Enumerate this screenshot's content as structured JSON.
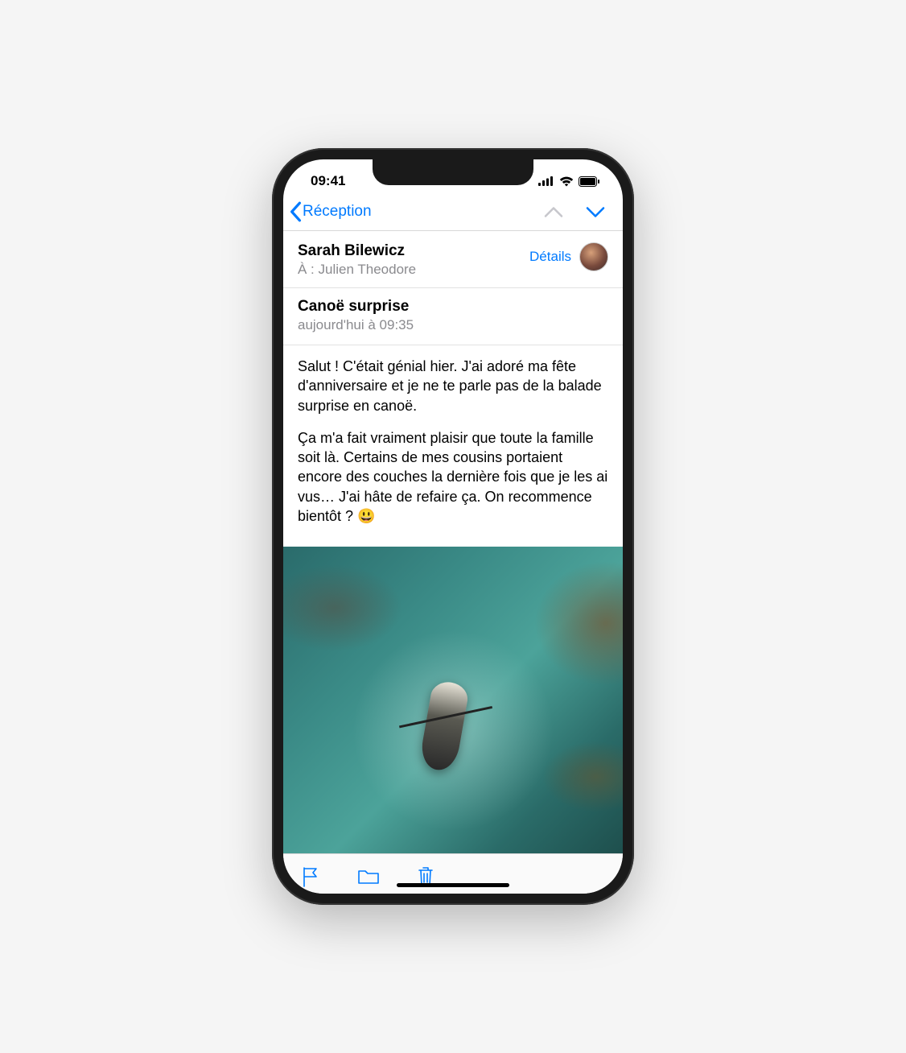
{
  "status": {
    "time": "09:41"
  },
  "nav": {
    "back_label": "Réception"
  },
  "email": {
    "sender": "Sarah Bilewicz",
    "to_label": "À :",
    "recipient": "Julien Theodore",
    "details_label": "Détails",
    "subject": "Canoë surprise",
    "timestamp": "aujourd'hui à 09:35",
    "body_p1": "Salut ! C'était génial hier. J'ai adoré ma fête d'anniversaire et je ne te parle pas de la balade surprise en canoë.",
    "body_p2": "Ça m'a fait vraiment plaisir que toute la famille soit là. Certains de mes cousins portaient encore des couches la dernière fois que je les ai vus… J'ai hâte de refaire ça. On recommence bientôt ? 😃"
  },
  "colors": {
    "accent": "#007aff",
    "secondary_text": "#8a8a8e"
  }
}
